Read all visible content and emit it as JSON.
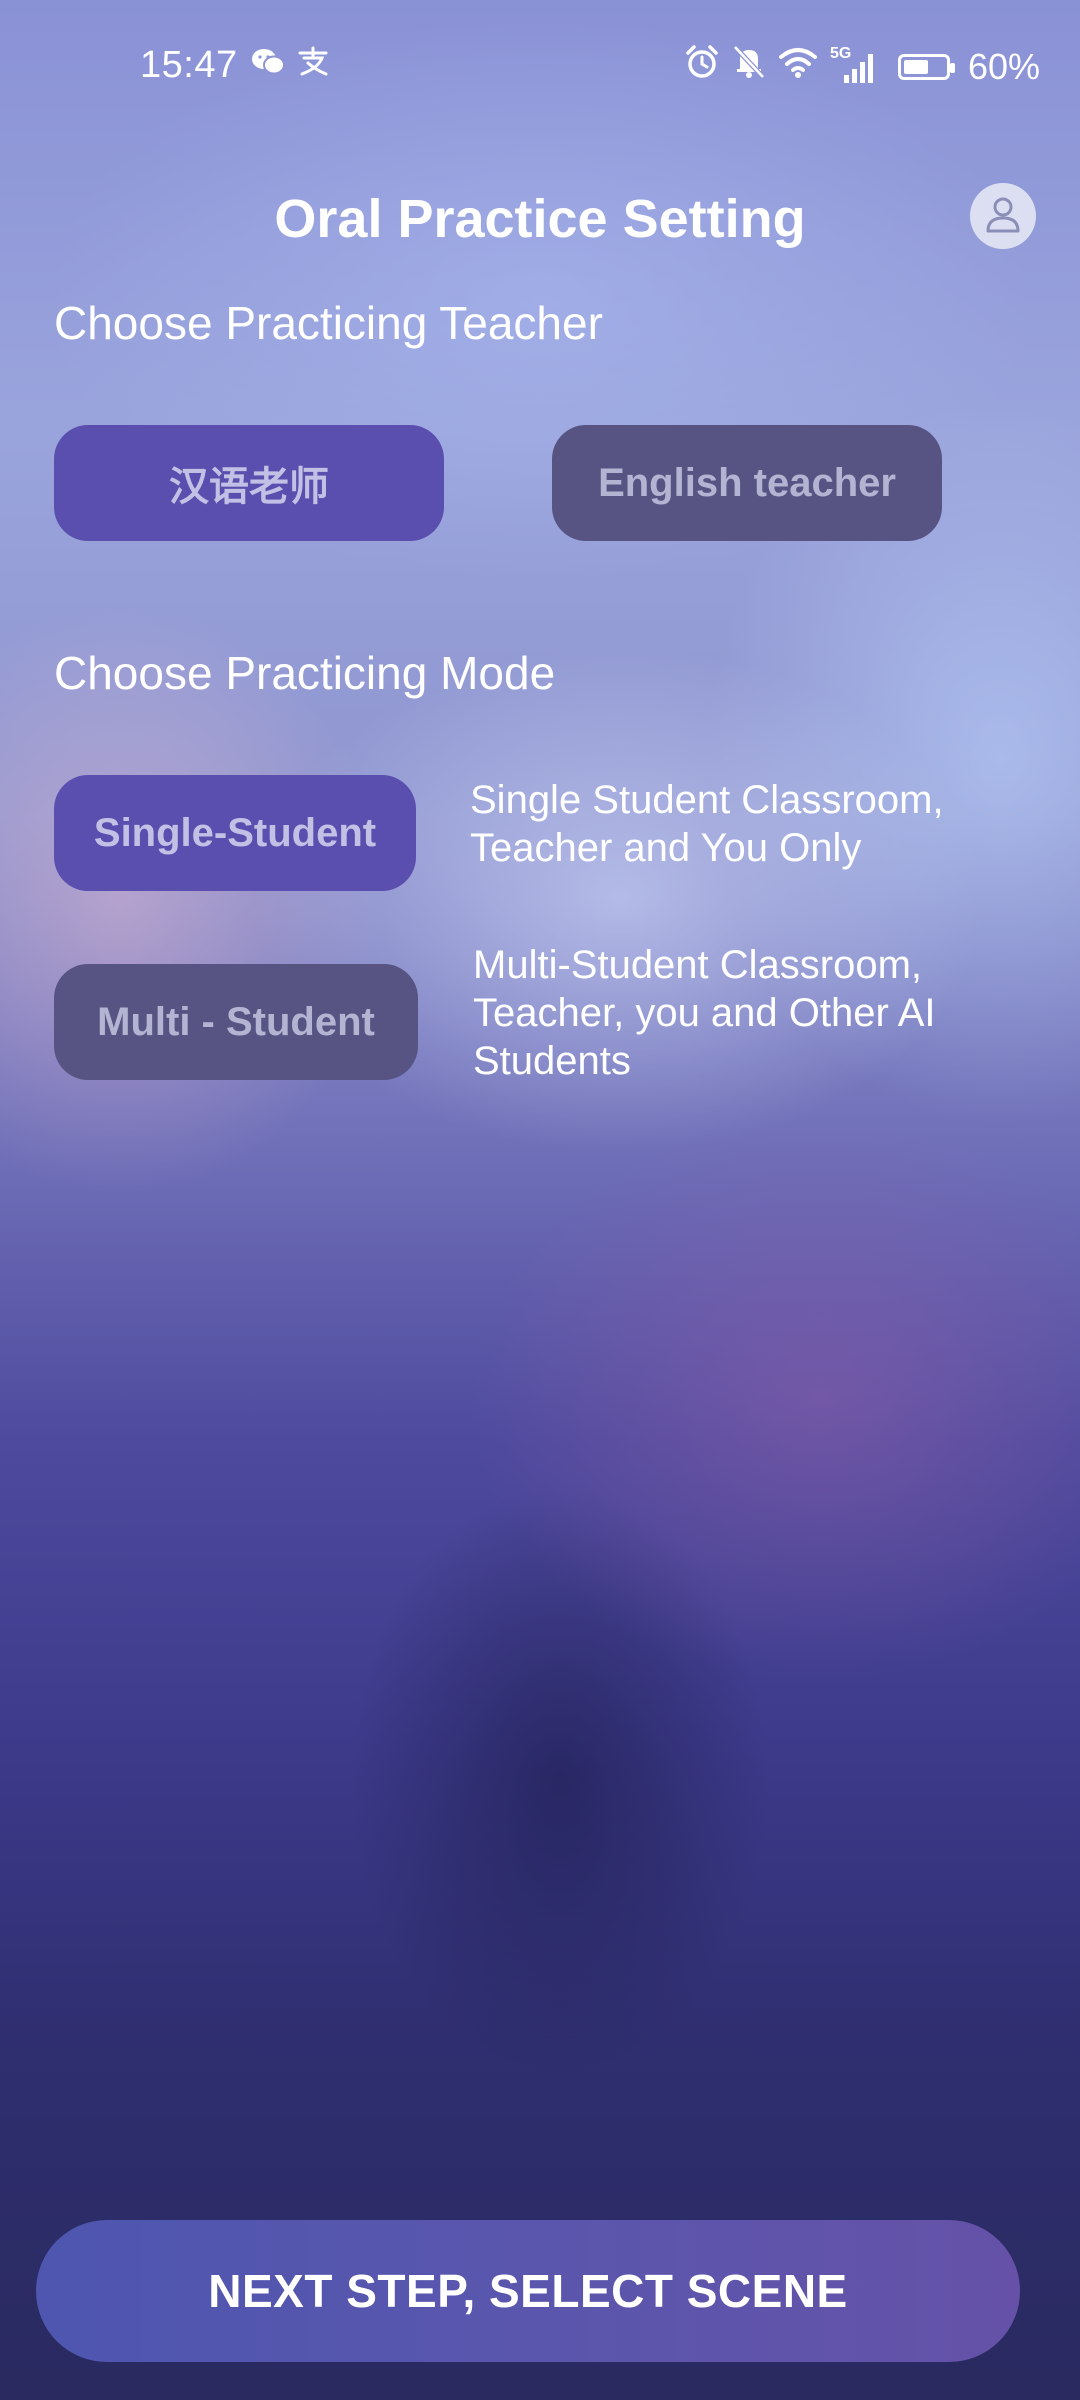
{
  "status_bar": {
    "time": "15:47",
    "battery_text": "60%",
    "battery_level": 0.6,
    "network_label": "5G",
    "icons": [
      "wechat-icon",
      "alipay-icon",
      "alarm-icon",
      "mute-icon",
      "wifi-icon",
      "signal-icon",
      "battery-icon"
    ]
  },
  "header": {
    "title": "Oral Practice Setting"
  },
  "teacher_section": {
    "title": "Choose Practicing Teacher",
    "options": [
      {
        "label": "汉语老师",
        "selected": true
      },
      {
        "label": "English teacher",
        "selected": false
      }
    ]
  },
  "mode_section": {
    "title": "Choose Practicing Mode",
    "options": [
      {
        "label": "Single-Student",
        "selected": true,
        "description_lines": [
          "Single Student Classroom,",
          "Teacher and You Only"
        ]
      },
      {
        "label": "Multi - Student",
        "selected": false,
        "description_lines": [
          "Multi-Student Classroom,",
          "Teacher, you and Other AI",
          "Students"
        ]
      }
    ]
  },
  "footer": {
    "next_button_label": "NEXT STEP, SELECT SCENE"
  },
  "colors": {
    "selected_pill": "#5a4fae",
    "unselected_pill": "#575483",
    "button_gradient_start": "#4e56b0",
    "button_gradient_end": "#6552a8"
  }
}
